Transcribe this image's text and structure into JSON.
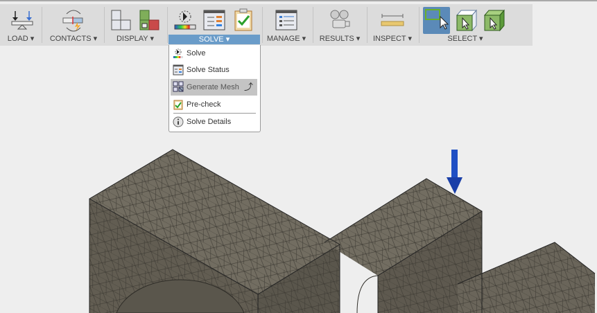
{
  "toolbar": {
    "groups": [
      {
        "label": "LOAD ▾"
      },
      {
        "label": "CONTACTS ▾"
      },
      {
        "label": "DISPLAY ▾"
      },
      {
        "label": "SOLVE ▾",
        "active": true
      },
      {
        "label": "MANAGE ▾"
      },
      {
        "label": "RESULTS ▾"
      },
      {
        "label": "INSPECT ▾"
      },
      {
        "label": "SELECT ▾"
      }
    ],
    "active_color": "#6a9cc9"
  },
  "solve_menu": {
    "items": [
      {
        "label": "Solve",
        "icon": "solve-icon"
      },
      {
        "label": "Solve Status",
        "icon": "solve-status-icon"
      },
      {
        "label": "Generate Mesh",
        "icon": "mesh-icon",
        "highlighted": true
      },
      {
        "label": "Pre-check",
        "icon": "precheck-icon"
      },
      {
        "label": "Solve Details",
        "icon": "info-icon"
      }
    ]
  },
  "model": {
    "load_arrow_color": "#1f4fc4",
    "mesh_color": "#6b665a"
  }
}
